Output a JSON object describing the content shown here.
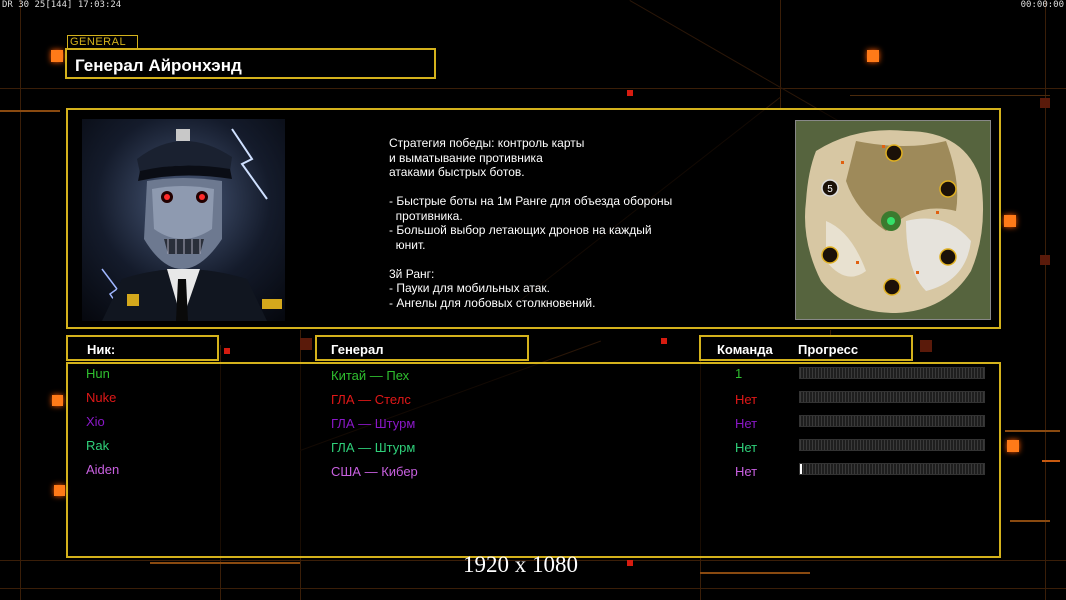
{
  "hud": {
    "left": "DR 30 25[144] 17:03:24",
    "right": "00:00:00"
  },
  "general_tag": "GENERAL",
  "title": "Генерал Айронхэнд",
  "description": "Стратегия победы: контроль карты\nи выматывание противника\nатаками быстрых ботов.\n\n- Быстрые боты на 1м Ранге для объезда обороны\n  противника.\n- Большой выбор летающих дронов на каждый\n  юнит.\n\n3й Ранг:\n- Пауки для мобильных атак.\n- Ангелы для лобовых столкновений.",
  "headers": {
    "nick": "Ник:",
    "general": "Генерал",
    "team": "Команда",
    "progress": "Прогресс"
  },
  "players": [
    {
      "nick": "Hun",
      "general": "Китай — Пех",
      "team": "1",
      "color": "#2fbf2f",
      "progress": 0
    },
    {
      "nick": "Nuke",
      "general": "ГЛА — Стелс",
      "team": "Нет",
      "color": "#e01818",
      "progress": 0
    },
    {
      "nick": "Xio",
      "general": "ГЛА — Штурм",
      "team": "Нет",
      "color": "#8a18c8",
      "progress": 0
    },
    {
      "nick": "Rak",
      "general": "ГЛА — Штурм",
      "team": "Нет",
      "color": "#2fd07a",
      "progress": 0
    },
    {
      "nick": "Aiden",
      "general": "США — Кибер",
      "team": "Нет",
      "color": "#c860e0",
      "progress": 0.01
    }
  ],
  "map_marker": "5",
  "resolution": "1920 x 1080"
}
